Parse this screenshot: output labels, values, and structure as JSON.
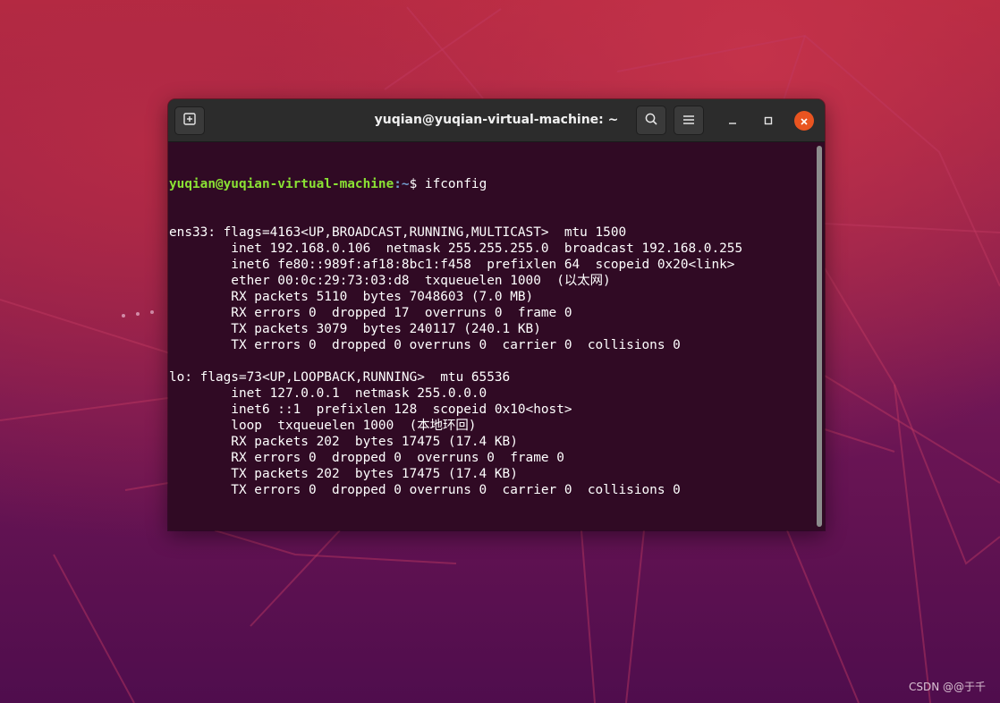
{
  "window": {
    "title": "yuqian@yuqian-virtual-machine: ~"
  },
  "header_buttons": {
    "new_tab_icon": "new-tab-icon",
    "search_icon": "search-icon",
    "menu_icon": "hamburger-menu-icon",
    "minimize_icon": "minimize-icon",
    "maximize_icon": "maximize-icon",
    "close_icon": "close-icon"
  },
  "terminal": {
    "prompt_user": "yuqian@yuqian-virtual-machine",
    "prompt_path": ":~",
    "prompt_symbol": "$ ",
    "command": "ifconfig",
    "output": [
      "ens33: flags=4163<UP,BROADCAST,RUNNING,MULTICAST>  mtu 1500",
      "        inet 192.168.0.106  netmask 255.255.255.0  broadcast 192.168.0.255",
      "        inet6 fe80::989f:af18:8bc1:f458  prefixlen 64  scopeid 0x20<link>",
      "        ether 00:0c:29:73:03:d8  txqueuelen 1000  (以太网)",
      "        RX packets 5110  bytes 7048603 (7.0 MB)",
      "        RX errors 0  dropped 17  overruns 0  frame 0",
      "        TX packets 3079  bytes 240117 (240.1 KB)",
      "        TX errors 0  dropped 0 overruns 0  carrier 0  collisions 0",
      "",
      "lo: flags=73<UP,LOOPBACK,RUNNING>  mtu 65536",
      "        inet 127.0.0.1  netmask 255.0.0.0",
      "        inet6 ::1  prefixlen 128  scopeid 0x10<host>",
      "        loop  txqueuelen 1000  (本地环回)",
      "        RX packets 202  bytes 17475 (17.4 KB)",
      "        RX errors 0  dropped 0  overruns 0  frame 0",
      "        TX packets 202  bytes 17475 (17.4 KB)",
      "        TX errors 0  dropped 0 overruns 0  carrier 0  collisions 0",
      ""
    ]
  },
  "watermark": "CSDN @@于千",
  "colors": {
    "terminal_bg": "#300a24",
    "prompt_user": "#8ae234",
    "prompt_path": "#729fcf",
    "close_button": "#e95420",
    "titlebar": "#2c2c2c"
  }
}
